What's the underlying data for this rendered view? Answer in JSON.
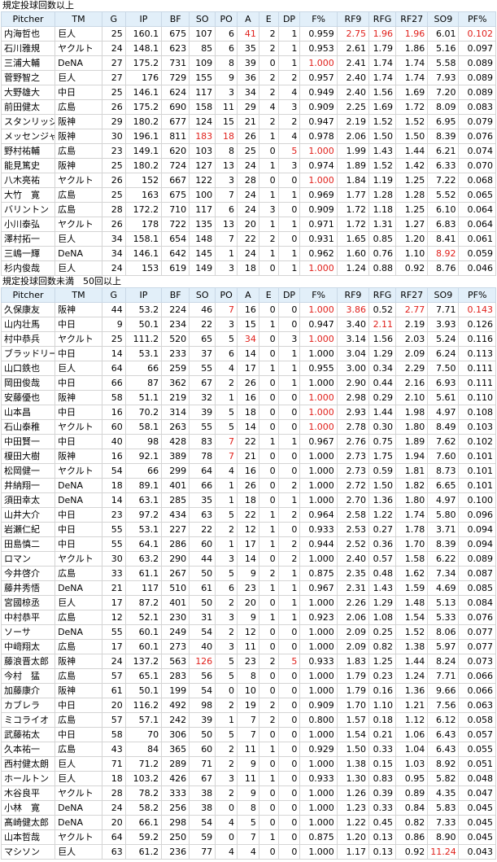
{
  "columns": [
    "Pitcher",
    "TM",
    "G",
    "IP",
    "BF",
    "SO",
    "PO",
    "A",
    "E",
    "DP",
    "F%",
    "RF9",
    "RFG",
    "RF27",
    "SO9",
    "PF%"
  ],
  "sections": [
    {
      "title": "規定投球回数以上",
      "rows": [
        [
          "内海哲也",
          "巨人",
          "25",
          "160.1",
          "675",
          "107",
          "6",
          "41",
          "2",
          "1",
          "0.959",
          "2.75",
          "1.96",
          "1.96",
          "6.01",
          "0.102"
        ],
        [
          "石川雅規",
          "ヤクルト",
          "24",
          "148.1",
          "623",
          "85",
          "6",
          "35",
          "2",
          "1",
          "0.953",
          "2.61",
          "1.79",
          "1.86",
          "5.16",
          "0.097"
        ],
        [
          "三浦大輔",
          "DeNA",
          "27",
          "175.2",
          "731",
          "109",
          "8",
          "39",
          "0",
          "1",
          "1.000",
          "2.41",
          "1.74",
          "1.74",
          "5.58",
          "0.089"
        ],
        [
          "菅野智之",
          "巨人",
          "27",
          "176",
          "729",
          "155",
          "9",
          "36",
          "2",
          "2",
          "0.957",
          "2.40",
          "1.74",
          "1.74",
          "7.93",
          "0.089"
        ],
        [
          "大野雄大",
          "中日",
          "25",
          "146.1",
          "624",
          "117",
          "3",
          "34",
          "2",
          "4",
          "0.949",
          "2.40",
          "1.56",
          "1.69",
          "7.20",
          "0.089"
        ],
        [
          "前田健太",
          "広島",
          "26",
          "175.2",
          "690",
          "158",
          "11",
          "29",
          "4",
          "3",
          "0.909",
          "2.25",
          "1.69",
          "1.72",
          "8.09",
          "0.083"
        ],
        [
          "スタンリッジ",
          "阪神",
          "29",
          "180.2",
          "677",
          "124",
          "15",
          "21",
          "2",
          "2",
          "0.947",
          "2.19",
          "1.52",
          "1.52",
          "6.95",
          "0.079"
        ],
        [
          "メッセンジャー",
          "阪神",
          "30",
          "196.1",
          "811",
          "183",
          "18",
          "26",
          "1",
          "4",
          "0.978",
          "2.06",
          "1.50",
          "1.50",
          "8.39",
          "0.076"
        ],
        [
          "野村祐輔",
          "広島",
          "23",
          "149.1",
          "620",
          "103",
          "8",
          "25",
          "0",
          "5",
          "1.000",
          "1.99",
          "1.43",
          "1.44",
          "6.21",
          "0.074"
        ],
        [
          "能見篤史",
          "阪神",
          "25",
          "180.2",
          "724",
          "127",
          "13",
          "24",
          "1",
          "3",
          "0.974",
          "1.89",
          "1.52",
          "1.42",
          "6.33",
          "0.070"
        ],
        [
          "八木亮祐",
          "ヤクルト",
          "26",
          "152",
          "667",
          "122",
          "3",
          "28",
          "0",
          "0",
          "1.000",
          "1.84",
          "1.19",
          "1.25",
          "7.22",
          "0.068"
        ],
        [
          "大竹　寛",
          "広島",
          "25",
          "163",
          "675",
          "100",
          "7",
          "24",
          "1",
          "1",
          "0.969",
          "1.77",
          "1.28",
          "1.28",
          "5.52",
          "0.065"
        ],
        [
          "バリントン",
          "広島",
          "28",
          "172.2",
          "710",
          "117",
          "6",
          "24",
          "3",
          "0",
          "0.909",
          "1.72",
          "1.18",
          "1.25",
          "6.10",
          "0.064"
        ],
        [
          "小川泰弘",
          "ヤクルト",
          "26",
          "178",
          "722",
          "135",
          "13",
          "20",
          "1",
          "1",
          "0.971",
          "1.72",
          "1.31",
          "1.27",
          "6.83",
          "0.064"
        ],
        [
          "澤村拓一",
          "巨人",
          "34",
          "158.1",
          "654",
          "148",
          "7",
          "22",
          "2",
          "0",
          "0.931",
          "1.65",
          "0.85",
          "1.20",
          "8.41",
          "0.061"
        ],
        [
          "三嶋一輝",
          "DeNA",
          "34",
          "146.1",
          "642",
          "145",
          "1",
          "24",
          "1",
          "1",
          "0.962",
          "1.60",
          "0.76",
          "1.10",
          "8.92",
          "0.059"
        ],
        [
          "杉内俊哉",
          "巨人",
          "24",
          "153",
          "619",
          "149",
          "3",
          "18",
          "0",
          "1",
          "1.000",
          "1.24",
          "0.88",
          "0.92",
          "8.76",
          "0.046"
        ]
      ]
    },
    {
      "title": "規定投球回数未満　50回以上",
      "rows": [
        [
          "久保康友",
          "阪神",
          "44",
          "53.2",
          "224",
          "46",
          "7",
          "16",
          "0",
          "0",
          "1.000",
          "3.86",
          "0.52",
          "2.77",
          "7.71",
          "0.143"
        ],
        [
          "山内壮馬",
          "中日",
          "9",
          "50.1",
          "234",
          "22",
          "3",
          "15",
          "1",
          "0",
          "0.947",
          "3.40",
          "2.11",
          "2.19",
          "3.93",
          "0.126"
        ],
        [
          "村中恭兵",
          "ヤクルト",
          "25",
          "111.2",
          "520",
          "65",
          "5",
          "34",
          "0",
          "3",
          "1.000",
          "3.14",
          "1.56",
          "2.03",
          "5.24",
          "0.116"
        ],
        [
          "ブラッドリー",
          "中日",
          "14",
          "53.1",
          "233",
          "37",
          "6",
          "14",
          "0",
          "1",
          "1.000",
          "3.04",
          "1.29",
          "2.09",
          "6.24",
          "0.113"
        ],
        [
          "山口鉄也",
          "巨人",
          "64",
          "66",
          "259",
          "55",
          "4",
          "17",
          "1",
          "1",
          "0.955",
          "3.00",
          "0.34",
          "2.29",
          "7.50",
          "0.111"
        ],
        [
          "岡田俊哉",
          "中日",
          "66",
          "87",
          "362",
          "67",
          "2",
          "26",
          "0",
          "1",
          "1.000",
          "2.90",
          "0.44",
          "2.16",
          "6.93",
          "0.111"
        ],
        [
          "安藤優也",
          "阪神",
          "58",
          "51.1",
          "219",
          "32",
          "1",
          "16",
          "0",
          "0",
          "1.000",
          "2.98",
          "0.29",
          "2.10",
          "5.61",
          "0.110"
        ],
        [
          "山本昌",
          "中日",
          "16",
          "70.2",
          "314",
          "39",
          "5",
          "18",
          "0",
          "0",
          "1.000",
          "2.93",
          "1.44",
          "1.98",
          "4.97",
          "0.108"
        ],
        [
          "石山泰稚",
          "ヤクルト",
          "60",
          "58.1",
          "263",
          "55",
          "5",
          "14",
          "0",
          "0",
          "1.000",
          "2.78",
          "0.30",
          "1.80",
          "8.49",
          "0.103"
        ],
        [
          "中田賢一",
          "中日",
          "40",
          "98",
          "428",
          "83",
          "7",
          "22",
          "1",
          "1",
          "0.967",
          "2.76",
          "0.75",
          "1.89",
          "7.62",
          "0.102"
        ],
        [
          "榎田大樹",
          "阪神",
          "16",
          "92.1",
          "389",
          "78",
          "7",
          "21",
          "0",
          "0",
          "1.000",
          "2.73",
          "1.75",
          "1.94",
          "7.60",
          "0.101"
        ],
        [
          "松岡健一",
          "ヤクルト",
          "54",
          "66",
          "299",
          "64",
          "4",
          "16",
          "0",
          "0",
          "1.000",
          "2.73",
          "0.59",
          "1.81",
          "8.73",
          "0.101"
        ],
        [
          "井納翔一",
          "DeNA",
          "18",
          "89.1",
          "401",
          "66",
          "1",
          "26",
          "0",
          "2",
          "1.000",
          "2.72",
          "1.50",
          "1.82",
          "6.65",
          "0.101"
        ],
        [
          "須田幸太",
          "DeNA",
          "14",
          "63.1",
          "285",
          "35",
          "1",
          "18",
          "0",
          "1",
          "1.000",
          "2.70",
          "1.36",
          "1.80",
          "4.97",
          "0.100"
        ],
        [
          "山井大介",
          "中日",
          "23",
          "97.2",
          "434",
          "63",
          "5",
          "22",
          "1",
          "2",
          "0.964",
          "2.58",
          "1.22",
          "1.74",
          "5.80",
          "0.096"
        ],
        [
          "岩瀬仁紀",
          "中日",
          "55",
          "53.1",
          "227",
          "22",
          "2",
          "12",
          "1",
          "0",
          "0.933",
          "2.53",
          "0.27",
          "1.78",
          "3.71",
          "0.094"
        ],
        [
          "田島慎二",
          "中日",
          "55",
          "64.1",
          "286",
          "60",
          "1",
          "17",
          "1",
          "2",
          "0.944",
          "2.52",
          "0.36",
          "1.70",
          "8.39",
          "0.094"
        ],
        [
          "ロマン",
          "ヤクルト",
          "30",
          "63.2",
          "290",
          "44",
          "3",
          "14",
          "0",
          "2",
          "1.000",
          "2.40",
          "0.57",
          "1.58",
          "6.22",
          "0.089"
        ],
        [
          "今井啓介",
          "広島",
          "33",
          "61.1",
          "267",
          "50",
          "5",
          "9",
          "2",
          "1",
          "0.875",
          "2.35",
          "0.48",
          "1.62",
          "7.34",
          "0.087"
        ],
        [
          "藤井秀悟",
          "DeNA",
          "21",
          "117",
          "510",
          "61",
          "6",
          "23",
          "1",
          "1",
          "0.967",
          "2.31",
          "1.43",
          "1.59",
          "4.69",
          "0.085"
        ],
        [
          "宮國椋丞",
          "巨人",
          "17",
          "87.2",
          "401",
          "50",
          "2",
          "20",
          "0",
          "1",
          "1.000",
          "2.26",
          "1.29",
          "1.48",
          "5.13",
          "0.084"
        ],
        [
          "中村恭平",
          "広島",
          "12",
          "52.1",
          "230",
          "31",
          "3",
          "9",
          "1",
          "1",
          "0.923",
          "2.06",
          "1.08",
          "1.54",
          "5.33",
          "0.076"
        ],
        [
          "ソーサ",
          "DeNA",
          "55",
          "60.1",
          "249",
          "54",
          "2",
          "12",
          "0",
          "0",
          "1.000",
          "2.09",
          "0.25",
          "1.52",
          "8.06",
          "0.077"
        ],
        [
          "中﨑翔太",
          "広島",
          "17",
          "60.1",
          "273",
          "40",
          "3",
          "11",
          "0",
          "0",
          "1.000",
          "2.09",
          "0.82",
          "1.38",
          "5.97",
          "0.077"
        ],
        [
          "藤浪晋太郎",
          "阪神",
          "24",
          "137.2",
          "563",
          "126",
          "5",
          "23",
          "2",
          "5",
          "0.933",
          "1.83",
          "1.25",
          "1.44",
          "8.24",
          "0.073"
        ],
        [
          "今村　猛",
          "広島",
          "57",
          "65.1",
          "283",
          "56",
          "5",
          "8",
          "0",
          "0",
          "1.000",
          "1.79",
          "0.23",
          "1.24",
          "7.71",
          "0.066"
        ],
        [
          "加藤康介",
          "阪神",
          "61",
          "50.1",
          "199",
          "54",
          "0",
          "10",
          "0",
          "0",
          "1.000",
          "1.79",
          "0.16",
          "1.36",
          "9.66",
          "0.066"
        ],
        [
          "カブレラ",
          "中日",
          "20",
          "116.2",
          "492",
          "98",
          "2",
          "19",
          "2",
          "0",
          "0.909",
          "1.70",
          "1.10",
          "1.21",
          "7.56",
          "0.063"
        ],
        [
          "ミコライオ",
          "広島",
          "57",
          "57.1",
          "242",
          "39",
          "1",
          "7",
          "2",
          "0",
          "0.800",
          "1.57",
          "0.18",
          "1.12",
          "6.12",
          "0.058"
        ],
        [
          "武藤祐太",
          "中日",
          "58",
          "70",
          "306",
          "50",
          "5",
          "7",
          "0",
          "0",
          "1.000",
          "1.54",
          "0.21",
          "1.06",
          "6.43",
          "0.057"
        ],
        [
          "久本祐一",
          "広島",
          "43",
          "84",
          "365",
          "60",
          "2",
          "11",
          "1",
          "0",
          "0.929",
          "1.50",
          "0.33",
          "1.04",
          "6.43",
          "0.055"
        ],
        [
          "西村健太朗",
          "巨人",
          "71",
          "71.2",
          "289",
          "71",
          "2",
          "9",
          "0",
          "0",
          "1.000",
          "1.38",
          "0.15",
          "1.03",
          "8.92",
          "0.051"
        ],
        [
          "ホールトン",
          "巨人",
          "18",
          "103.2",
          "426",
          "67",
          "3",
          "11",
          "1",
          "0",
          "0.933",
          "1.30",
          "0.83",
          "0.95",
          "5.82",
          "0.048"
        ],
        [
          "木谷良平",
          "ヤクルト",
          "28",
          "78.2",
          "333",
          "38",
          "2",
          "9",
          "0",
          "0",
          "1.000",
          "1.26",
          "0.39",
          "0.89",
          "4.35",
          "0.047"
        ],
        [
          "小林　寛",
          "DeNA",
          "24",
          "58.2",
          "256",
          "38",
          "0",
          "8",
          "0",
          "0",
          "1.000",
          "1.23",
          "0.33",
          "0.84",
          "5.83",
          "0.045"
        ],
        [
          "髙崎健太郎",
          "DeNA",
          "20",
          "66.1",
          "298",
          "54",
          "4",
          "5",
          "0",
          "0",
          "1.000",
          "1.22",
          "0.45",
          "0.82",
          "7.33",
          "0.045"
        ],
        [
          "山本哲哉",
          "ヤクルト",
          "64",
          "59.2",
          "250",
          "59",
          "0",
          "7",
          "1",
          "0",
          "0.875",
          "1.20",
          "0.13",
          "0.86",
          "8.90",
          "0.045"
        ],
        [
          "マシソン",
          "巨人",
          "63",
          "61.2",
          "236",
          "77",
          "4",
          "4",
          "0",
          "0",
          "1.000",
          "1.17",
          "0.13",
          "0.92",
          "11.24",
          "0.043"
        ]
      ]
    }
  ],
  "colors": {
    "header_bg": "#e2eff9",
    "grid": "#d4d4d4",
    "highlight": "#e0201b"
  },
  "highlights": [
    [
      [
        0,
        7
      ],
      [
        0,
        11
      ],
      [
        0,
        12
      ],
      [
        0,
        13
      ],
      [
        0,
        15
      ],
      [
        2,
        10
      ],
      [
        7,
        5
      ],
      [
        7,
        6
      ],
      [
        8,
        9
      ],
      [
        8,
        10
      ],
      [
        10,
        10
      ],
      [
        15,
        14
      ],
      [
        16,
        10
      ]
    ],
    [
      [
        0,
        6
      ],
      [
        0,
        10
      ],
      [
        0,
        11
      ],
      [
        0,
        13
      ],
      [
        0,
        15
      ],
      [
        1,
        12
      ],
      [
        2,
        7
      ],
      [
        2,
        10
      ],
      [
        6,
        10
      ],
      [
        7,
        10
      ],
      [
        8,
        10
      ],
      [
        9,
        6
      ],
      [
        10,
        6
      ],
      [
        24,
        5
      ],
      [
        24,
        9
      ],
      [
        37,
        14
      ]
    ]
  ]
}
